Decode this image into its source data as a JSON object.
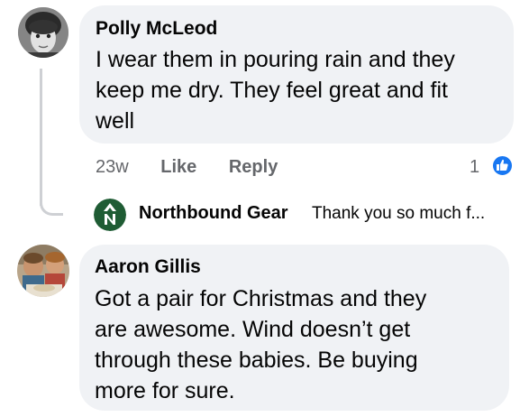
{
  "comments": [
    {
      "author": "Polly McLeod",
      "text": "I wear them in pouring rain and they\nkeep me dry.  They feel great and fit\nwell",
      "time": "23w",
      "like_label": "Like",
      "reply_label": "Reply",
      "reaction_count": "1",
      "reply_preview": {
        "author": "Northbound Gear",
        "text": "Thank you so much f..."
      }
    },
    {
      "author": "Aaron Gillis",
      "text": "Got a pair for Christmas and they\nare awesome. Wind doesn’t get\nthrough these babies. Be buying\nmore for sure."
    }
  ],
  "colors": {
    "bubble": "#f0f2f5",
    "meta": "#65676b",
    "like_blue": "#1877f2",
    "brand_green": "#1f5c34"
  },
  "icons": {
    "reaction": "thumbs-up-icon",
    "brand": "northbound-logo-icon"
  }
}
